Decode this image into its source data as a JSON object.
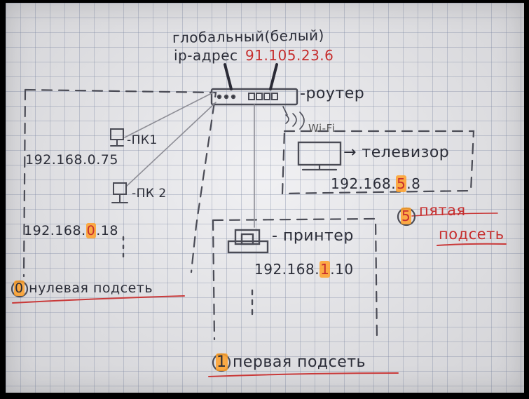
{
  "router": {
    "ip_caption_line1": "глобальный(белый)",
    "ip_caption_line2": "ip-адрес",
    "global_ip": "91.105.23.6",
    "label": "-роутер",
    "wifi_label": "Wi-Fi"
  },
  "subnet0": {
    "pc1_label": "-ПК1",
    "pc1_ip": "192.168.0.75",
    "pc2_label": "-ПК 2",
    "pc2_ip_prefix": "192.168.",
    "pc2_ip_subnet": "0",
    "pc2_ip_suffix": ".18",
    "number": "0",
    "name": "нулевая подсеть"
  },
  "subnet1": {
    "printer_label": "- принтер",
    "printer_ip_prefix": "192.168.",
    "printer_ip_subnet": "1",
    "printer_ip_suffix": ".10",
    "number": "1",
    "name": "первая подсеть"
  },
  "subnet5": {
    "tv_label": "→ телевизор",
    "tv_ip_prefix": "192.168.",
    "tv_ip_subnet": "5",
    "tv_ip_suffix": ".8",
    "number": "5",
    "name_line1": "пятая",
    "name_line2": "подсеть"
  },
  "colors": {
    "ink": "#2b2d38",
    "red_ink": "#c62e2e",
    "highlighter": "#ffa028",
    "paper": "#e9e9ed"
  }
}
